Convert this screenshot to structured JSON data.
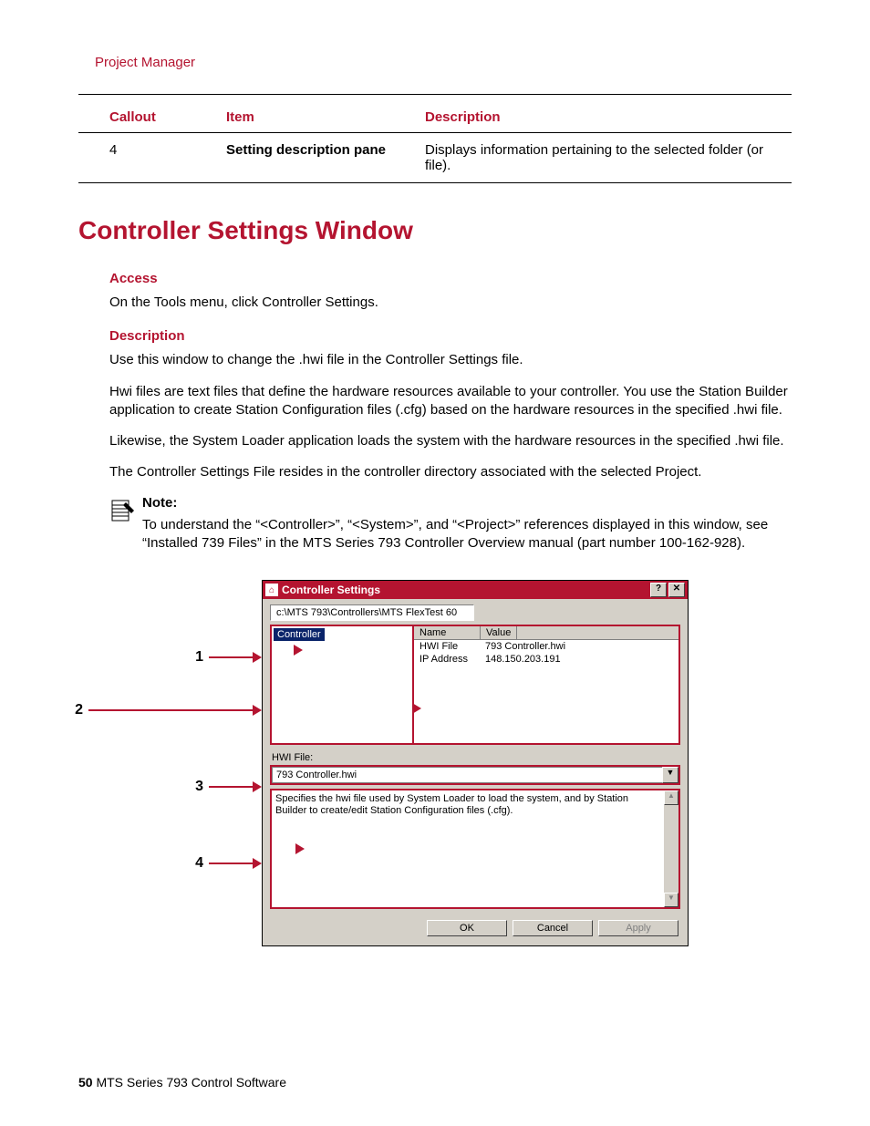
{
  "breadcrumb": "Project Manager",
  "table": {
    "headers": [
      "Callout",
      "Item",
      "Description"
    ],
    "rows": [
      {
        "c": "4",
        "item": "Setting description pane",
        "desc": "Displays information pertaining to the selected folder (or file)."
      }
    ]
  },
  "section_title": "Controller Settings Window",
  "access_head": "Access",
  "access_text": "On the Tools menu, click Controller Settings.",
  "desc_head": "Description",
  "p1": "Use this window to change the .hwi file in the Controller Settings file.",
  "p2": "Hwi files are text files that define the hardware resources available to your controller. You use the Station Builder application to create Station Configuration files (.cfg) based on the hardware resources in the specified .hwi file.",
  "p3": "Likewise, the System Loader application loads the system with the hardware resources in the specified .hwi file.",
  "p4": "The Controller Settings File resides in the controller directory associated with the selected Project.",
  "note_label": "Note:",
  "note_text": "To understand the “<Controller>”, “<System>”, and “<Project>” references displayed in this window, see “Installed 739 Files” in the MTS Series 793 Controller Overview manual (part number 100-162-928).",
  "callouts": [
    "1",
    "2",
    "3",
    "4"
  ],
  "win": {
    "title": "Controller Settings",
    "help": "?",
    "close": "✕",
    "path": "c:\\MTS 793\\Controllers\\MTS FlexTest 60",
    "tree_selected": "Controller",
    "prop_head_name": "Name",
    "prop_head_value": "Value",
    "props": [
      {
        "name": "HWI File",
        "value": "793 Controller.hwi"
      },
      {
        "name": "IP Address",
        "value": "148.150.203.191"
      }
    ],
    "hwi_label": "HWI File:",
    "hwi_value": "793 Controller.hwi",
    "dd_caret": "▼",
    "desc": "Specifies the hwi file used by System Loader to load the system, and by Station Builder to create/edit Station Configuration files (.cfg).",
    "sb_up": "▲",
    "sb_dn": "▼",
    "ok": "OK",
    "cancel": "Cancel",
    "apply": "Apply"
  },
  "footer_page": "50",
  "footer_text": "  MTS Series 793 Control Software"
}
